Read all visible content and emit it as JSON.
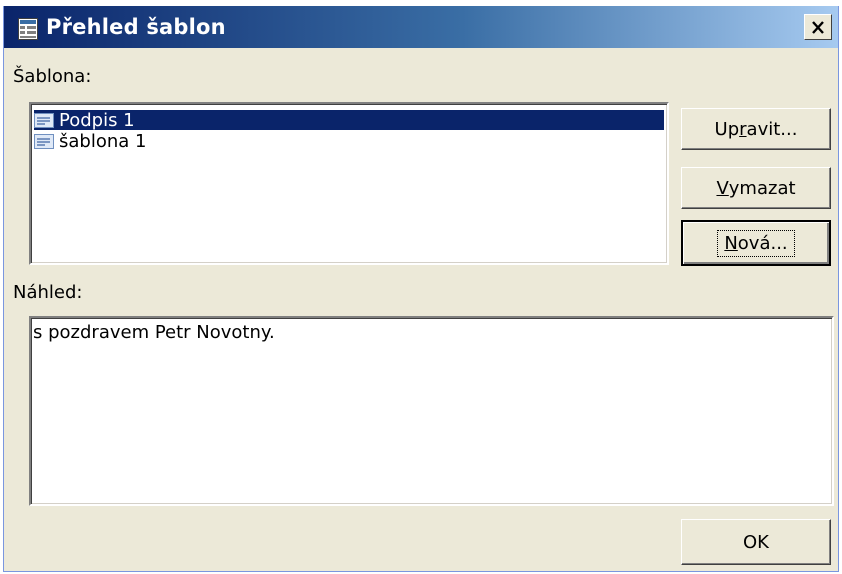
{
  "window": {
    "title": "Přehled šablon",
    "colors": {
      "titlebar_start": "#0a246a",
      "selection": "#0a246a",
      "face": "#ece9d8"
    }
  },
  "template_label": "Šablona:",
  "templates": [
    {
      "label": "Podpis 1",
      "selected": true,
      "icon": "document-icon"
    },
    {
      "label": "šablona 1",
      "selected": false,
      "icon": "document-icon"
    }
  ],
  "buttons": {
    "edit": {
      "pre": "Up",
      "acc": "r",
      "post": "avit..."
    },
    "delete": {
      "pre": "",
      "acc": "V",
      "post": "ymazat"
    },
    "new": {
      "pre": "",
      "acc": "N",
      "post": "ová..."
    },
    "ok": "OK"
  },
  "preview_label": "Náhled:",
  "preview_text": "s pozdravem Petr Novotny."
}
